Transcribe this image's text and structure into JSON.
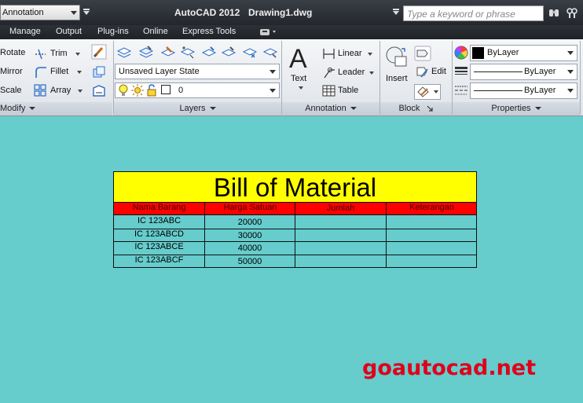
{
  "titlebar": {
    "workspace": "Annotation",
    "app_title": "AutoCAD 2012",
    "doc_title": "Drawing1.dwg",
    "search_placeholder": "Type a keyword or phrase"
  },
  "tabs": [
    "Manage",
    "Output",
    "Plug-ins",
    "Online",
    "Express Tools"
  ],
  "ribbon": {
    "modify": {
      "label": "Modify",
      "rotate": "Rotate",
      "mirror": "Mirror",
      "scale": "Scale",
      "trim": "Trim",
      "fillet": "Fillet",
      "array": "Array"
    },
    "layers": {
      "label": "Layers",
      "layer_state": "Unsaved Layer State",
      "current_layer": "0"
    },
    "annotation": {
      "label": "Annotation",
      "text": "Text",
      "linear": "Linear",
      "leader": "Leader",
      "table": "Table"
    },
    "block": {
      "label": "Block",
      "insert": "Insert",
      "edit": "Edit"
    },
    "properties": {
      "label": "Properties",
      "color": "ByLayer",
      "linetype": "ByLayer",
      "lineweight": "ByLayer"
    }
  },
  "bom": {
    "title": "Bill of Material",
    "headers": [
      "Nama Barang",
      "Harga Satuan",
      "Jumlah",
      "Keterangan"
    ],
    "rows": [
      [
        "IC 123ABC",
        "20000",
        "",
        ""
      ],
      [
        "IC 123ABCD",
        "30000",
        "",
        ""
      ],
      [
        "IC 123ABCE",
        "40000",
        "",
        ""
      ],
      [
        "IC 123ABCF",
        "50000",
        "",
        ""
      ]
    ],
    "title_color": "#ffff00",
    "header_color": "#ff0000"
  },
  "watermark": "goautocad.net",
  "canvas_color": "#66cccc"
}
